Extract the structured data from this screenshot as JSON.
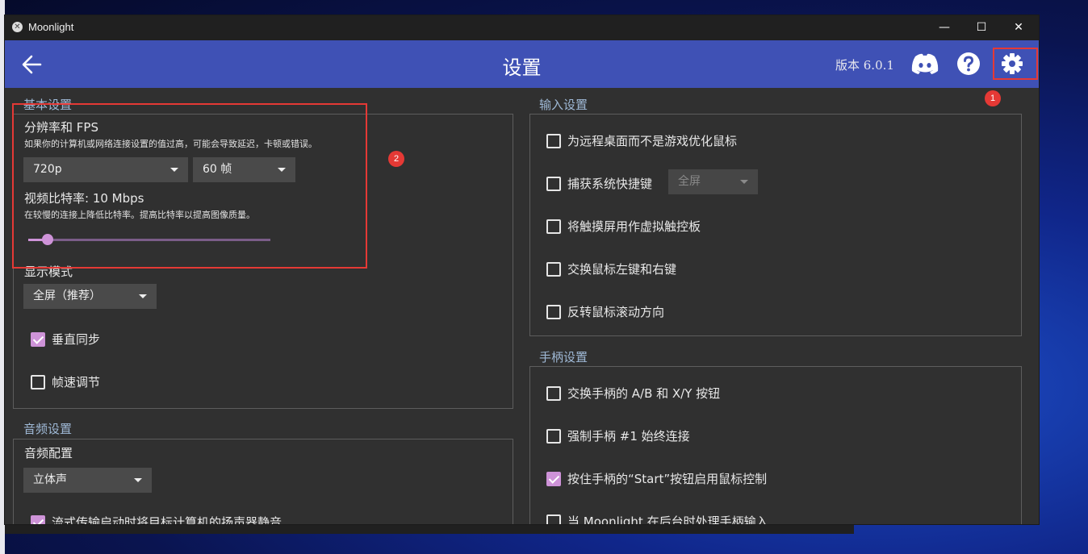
{
  "window": {
    "app_title": "Moonlight",
    "minimize": "—",
    "maximize": "☐",
    "close": "✕"
  },
  "topbar": {
    "title": "设置",
    "version": "版本 6.0.1",
    "icons": [
      "back-arrow-icon",
      "discord-icon",
      "help-icon",
      "gear-icon"
    ],
    "color": "#3f51b5"
  },
  "annotations": {
    "badge1": "1",
    "badge2": "2",
    "color": "#e53935"
  },
  "basic": {
    "section_title": "基本设置",
    "res_fps_label": "分辨率和 FPS",
    "res_fps_hint": "如果你的计算机或网络连接设置的值过高，可能会导致延迟，卡顿或错误。",
    "resolution": "720p",
    "fps": "60 帧",
    "bitrate_label": "视频比特率: 10 Mbps",
    "bitrate_hint": "在较慢的连接上降低比特率。提高比特率以提高图像质量。",
    "bitrate_slider_fraction": 0.08,
    "display_mode_label": "显示模式",
    "display_mode": "全屏（推荐）",
    "vsync_label": "垂直同步",
    "vsync_checked": true,
    "frame_pacing_label": "帧速调节",
    "frame_pacing_checked": false
  },
  "audio": {
    "section_title": "音频设置",
    "config_label": "音频配置",
    "config_value": "立体声",
    "mute_label": "流式传输启动时将目标计算机的扬声器静音",
    "mute_checked": true
  },
  "input": {
    "section_title": "输入设置",
    "items": [
      {
        "label": "为远程桌面而不是游戏优化鼠标",
        "checked": false
      },
      {
        "label": "捕获系统快捷键",
        "checked": false
      },
      {
        "label": "将触摸屏用作虚拟触控板",
        "checked": false
      },
      {
        "label": "交换鼠标左键和右键",
        "checked": false
      },
      {
        "label": "反转鼠标滚动方向",
        "checked": false
      }
    ],
    "shortcut_combo": "全屏"
  },
  "gamepad": {
    "section_title": "手柄设置",
    "items": [
      {
        "label": "交换手柄的 A/B 和 X/Y 按钮",
        "checked": false
      },
      {
        "label": "强制手柄 #1 始终连接",
        "checked": false
      },
      {
        "label": "按住手柄的“Start”按钮启用鼠标控制",
        "checked": true
      },
      {
        "label": "当 Moonlight 在后台时处理手柄输入",
        "checked": false
      }
    ]
  }
}
